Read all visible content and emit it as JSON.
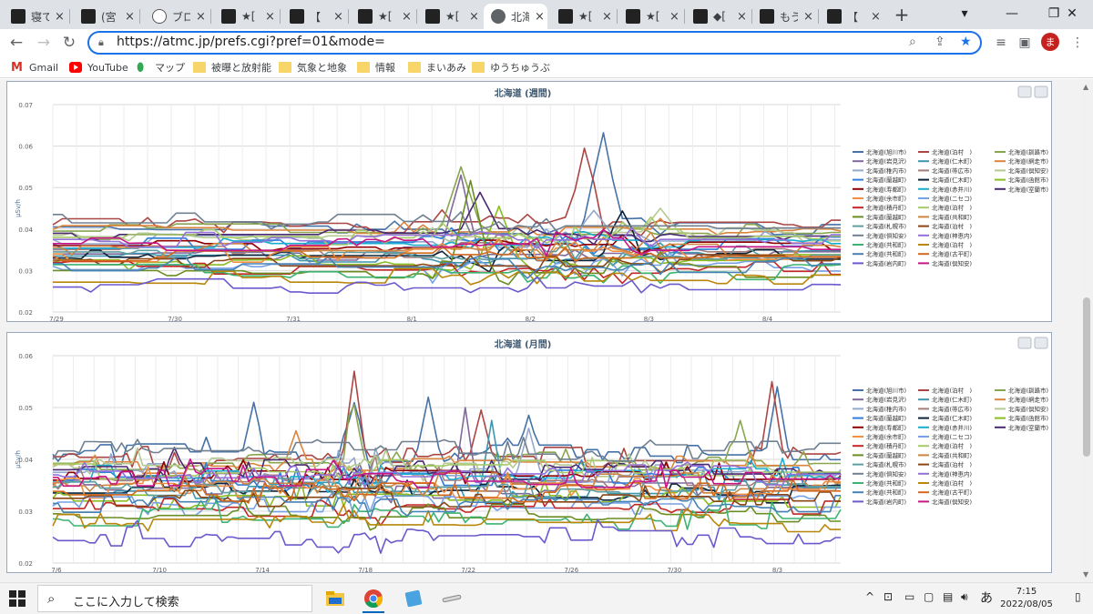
{
  "browser": {
    "tabs": [
      {
        "title": "寝て",
        "favicon": "bookmark-icon",
        "x": 0
      },
      {
        "title": "(宮",
        "favicon": "bookmark-icon",
        "x": 77
      },
      {
        "title": "ブロ",
        "favicon": "bookmark-icon",
        "x": 155
      },
      {
        "title": "★[",
        "favicon": "bookmark-icon",
        "x": 231
      },
      {
        "title": "【",
        "favicon": "bookmark-icon",
        "x": 306
      },
      {
        "title": "★[",
        "favicon": "bookmark-icon",
        "x": 381
      },
      {
        "title": "★[",
        "favicon": "bookmark-icon",
        "x": 455
      },
      {
        "title": "北海",
        "favicon": "globe-icon",
        "x": 527,
        "active": true
      },
      {
        "title": "★[",
        "favicon": "bookmark-icon",
        "x": 601
      },
      {
        "title": "★[",
        "favicon": "bookmark-icon",
        "x": 675
      },
      {
        "title": "◆[",
        "favicon": "bookmark-icon",
        "x": 749
      },
      {
        "title": "もう",
        "favicon": "bookmark-icon",
        "x": 822
      },
      {
        "title": "【",
        "favicon": "bookmark-icon",
        "x": 896
      }
    ],
    "url": "https://atmc.jp/prefs.cgi?pref=01&mode=",
    "avatar_initial": "ま",
    "bookmarks": [
      {
        "label": "Gmail",
        "icon": "gmail-icon"
      },
      {
        "label": "YouTube",
        "icon": "youtube-icon"
      },
      {
        "label": "マップ",
        "icon": "maps-icon"
      },
      {
        "label": "被曝と放射能",
        "icon": "folder-icon"
      },
      {
        "label": "気象と地象",
        "icon": "folder-icon"
      },
      {
        "label": "情報",
        "icon": "folder-icon"
      },
      {
        "label": "まいあみ",
        "icon": "folder-icon"
      },
      {
        "label": "ゆうちゅうぶ",
        "icon": "folder-icon"
      }
    ]
  },
  "legend_entries": [
    "北海道(旭川市)",
    "北海道(泊村　)",
    "北海道(釧路市)",
    "北海道(岩見沢)",
    "北海道(仁木町)",
    "北海道(網走市)",
    "北海道(稚内市)",
    "北海道(帯広市)",
    "北海道(倶知安)",
    "北海道(蘭越町)",
    "北海道(仁木町)",
    "北海道(函館市)",
    "北海道(寿都町)",
    "北海道(赤井川)",
    "北海道(室蘭市)",
    "北海道(余市町)",
    "北海道(ニセコ)",
    "北海道(積丹町)",
    "北海道(泊村　)",
    "北海道(蘭越町)",
    "北海道(共和町)",
    "北海道(札幌市)",
    "北海道(泊村　)",
    "北海道(倶知安)",
    "北海道(神恵内)",
    "北海道(共和町)",
    "北海道(泊村　)",
    "北海道(共和町)",
    "北海道(古平町)",
    "北海道(岩内町)",
    "北海道(倶知安)"
  ],
  "series_colors": [
    "#4572a7",
    "#aa4643",
    "#89a54e",
    "#80699b",
    "#3d96ae",
    "#db843d",
    "#92a8cd",
    "#a47d7c",
    "#b5ca92",
    "#2f7ed8",
    "#0d233a",
    "#8bbc21",
    "#910000",
    "#1aadce",
    "#492970",
    "#f28f43",
    "#77a1e5",
    "#c42525",
    "#a6c96a",
    "#6b8e23",
    "#cd853f",
    "#5f9ea0",
    "#8b4513",
    "#708090",
    "#9370db",
    "#3cb371",
    "#b8860b",
    "#4682b4",
    "#d2691e",
    "#6a5acd",
    "#c71585"
  ],
  "chart_data": [
    {
      "type": "line",
      "title": "北海道 (週間)",
      "ylabel": "μSv/h",
      "ylim": [
        0.02,
        0.07
      ],
      "yticks": [
        "0.07",
        "0.06",
        "0.05",
        "0.04",
        "0.03",
        "0.02"
      ],
      "xticks": [
        "7/29",
        "7/30",
        "7/31",
        "8/1",
        "8/2",
        "8/3",
        "8/4"
      ],
      "n_points": 84,
      "base_levels": [
        0.0405,
        0.041,
        0.0395,
        0.034,
        0.0335,
        0.04,
        0.0375,
        0.035,
        0.0385,
        0.0365,
        0.033,
        0.032,
        0.036,
        0.037,
        0.039,
        0.034,
        0.031,
        0.0305,
        0.038,
        0.03,
        0.0355,
        0.0345,
        0.0325,
        0.042,
        0.0375,
        0.0295,
        0.0285,
        0.0315,
        0.0335,
        0.026,
        0.0365
      ],
      "spikes": [
        {
          "series": 1,
          "at": 56,
          "value": 0.0595
        },
        {
          "series": 0,
          "at": 58,
          "value": 0.061
        },
        {
          "series": 2,
          "at": 43,
          "value": 0.055
        },
        {
          "series": 3,
          "at": 43,
          "value": 0.053
        },
        {
          "series": 19,
          "at": 44,
          "value": 0.051
        },
        {
          "series": 6,
          "at": 57,
          "value": 0.045
        },
        {
          "series": 10,
          "at": 60,
          "value": 0.046
        },
        {
          "series": 14,
          "at": 45,
          "value": 0.049
        },
        {
          "series": 8,
          "at": 64,
          "value": 0.045
        },
        {
          "series": 11,
          "at": 47,
          "value": 0.0455
        }
      ]
    },
    {
      "type": "line",
      "title": "北海道 (月間)",
      "ylabel": "μSv/h",
      "ylim": [
        0.02,
        0.06
      ],
      "yticks": [
        "0.06",
        "0.05",
        "0.04",
        "0.03",
        "0.02"
      ],
      "xticks": [
        "7/6",
        "7/10",
        "7/14",
        "7/18",
        "7/22",
        "7/26",
        "7/30",
        "8/3"
      ],
      "n_points": 150,
      "base_levels": [
        0.041,
        0.0405,
        0.0395,
        0.0345,
        0.034,
        0.039,
        0.0375,
        0.0355,
        0.0385,
        0.0365,
        0.0335,
        0.0325,
        0.036,
        0.037,
        0.038,
        0.0345,
        0.031,
        0.0305,
        0.038,
        0.0295,
        0.0355,
        0.0345,
        0.0325,
        0.0415,
        0.037,
        0.0285,
        0.028,
        0.0315,
        0.0335,
        0.025,
        0.0365
      ],
      "spikes": [
        {
          "series": 1,
          "at": 57,
          "value": 0.057
        },
        {
          "series": 0,
          "at": 57,
          "value": 0.0525
        },
        {
          "series": 2,
          "at": 57,
          "value": 0.0505
        },
        {
          "series": 0,
          "at": 38,
          "value": 0.051
        },
        {
          "series": 0,
          "at": 71,
          "value": 0.052
        },
        {
          "series": 3,
          "at": 78,
          "value": 0.05
        },
        {
          "series": 1,
          "at": 81,
          "value": 0.0495
        },
        {
          "series": 4,
          "at": 83,
          "value": 0.0475
        },
        {
          "series": 0,
          "at": 90,
          "value": 0.0485
        },
        {
          "series": 2,
          "at": 130,
          "value": 0.0475
        },
        {
          "series": 1,
          "at": 136,
          "value": 0.055
        },
        {
          "series": 0,
          "at": 137,
          "value": 0.054
        },
        {
          "series": 5,
          "at": 46,
          "value": 0.0455
        },
        {
          "series": 6,
          "at": 90,
          "value": 0.046
        }
      ]
    }
  ],
  "taskbar": {
    "search_placeholder": "ここに入力して検索",
    "ime_label": "あ",
    "time": "7:15",
    "date": "2022/08/05"
  }
}
